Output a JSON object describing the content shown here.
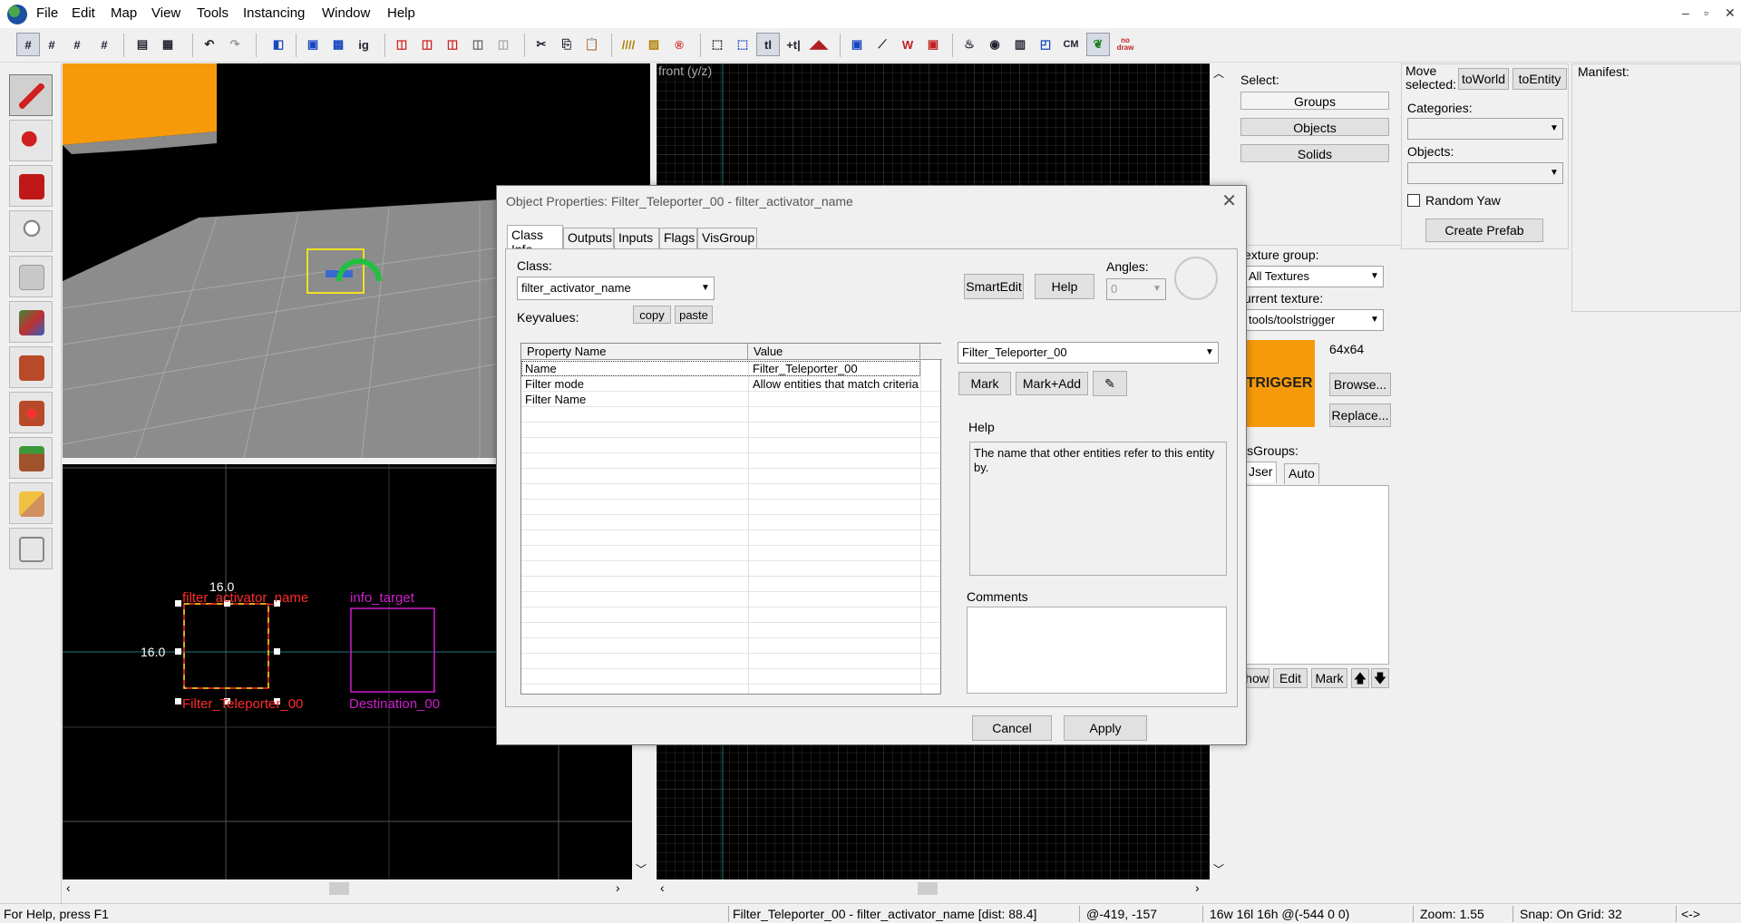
{
  "menubar": {
    "items": [
      "File",
      "Edit",
      "Map",
      "View",
      "Tools",
      "Instancing",
      "Window",
      "Help"
    ],
    "window_controls": [
      "–",
      "▫",
      "✕"
    ]
  },
  "toolbar": {
    "labels": {
      "ig": "ig",
      "tl": "tl",
      "cm": "CM",
      "nodraw": "no draw"
    }
  },
  "viewports": {
    "front_label": "front (y/z)",
    "top": {
      "dim_top": "16.0",
      "dim_left": "16.0",
      "entity1_top": "filter_activator_name",
      "entity1_bottom": "Filter_Teleporter_00",
      "entity2_top": "info_target",
      "entity2_bottom": "Destination_00"
    }
  },
  "select_panel": {
    "label": "Select:",
    "groups": "Groups",
    "objects": "Objects",
    "solids": "Solids"
  },
  "texture_panel": {
    "group_label": "exture group:",
    "group_value": "All Textures",
    "current_label": "urrent texture:",
    "current_value": "tools/toolstrigger",
    "size": "64x64",
    "swatch_text": "TRIGGER",
    "browse": "Browse...",
    "replace": "Replace...",
    "visgroups_label": "isGroups:",
    "tab_user": "Jser",
    "tab_auto": "Auto",
    "show": "how",
    "edit": "Edit",
    "mark": "Mark",
    "up": "🡅",
    "down": "🡇"
  },
  "prefab_panel": {
    "move_selected": "Move selected:",
    "to_world": "toWorld",
    "to_entity": "toEntity",
    "categories_label": "Categories:",
    "objects_label": "Objects:",
    "random_yaw": "Random Yaw",
    "create_prefab": "Create Prefab"
  },
  "manifest": {
    "label": "Manifest:"
  },
  "dialog": {
    "title": "Object Properties: Filter_Teleporter_00 - filter_activator_name",
    "tabs": [
      "Class Info",
      "Outputs",
      "Inputs",
      "Flags",
      "VisGroup"
    ],
    "class_label": "Class:",
    "class_value": "filter_activator_name",
    "keyvalues_label": "Keyvalues:",
    "copy": "copy",
    "paste": "paste",
    "smartedit": "SmartEdit",
    "help_btn": "Help",
    "angles_label": "Angles:",
    "angles_value": "0",
    "columns": [
      "Property Name",
      "Value"
    ],
    "rows": [
      {
        "name": "Name",
        "value": "Filter_Teleporter_00"
      },
      {
        "name": "Filter mode",
        "value": "Allow entities that match criteria"
      },
      {
        "name": "Filter Name",
        "value": ""
      }
    ],
    "value_combo": "Filter_Teleporter_00",
    "mark": "Mark",
    "mark_add": "Mark+Add",
    "help_label": "Help",
    "help_text": "The name that other entities refer to this entity by.",
    "comments_label": "Comments",
    "cancel": "Cancel",
    "apply": "Apply"
  },
  "statusbar": {
    "help": "For Help, press F1",
    "selection": "Filter_Teleporter_00 - filter_activator_name  [dist: 88.4]",
    "coords": "@-419, -157",
    "size": "16w 16l 16h @(-544 0 0)",
    "zoom": "Zoom: 1.55",
    "snap": "Snap: On Grid: 32",
    "arrows": "<->"
  },
  "colors": {
    "accent_orange": "#f79a0a",
    "entity_red": "#ff2a2a",
    "entity_magenta": "#d01ed0",
    "grid": "#4a4a4a"
  }
}
